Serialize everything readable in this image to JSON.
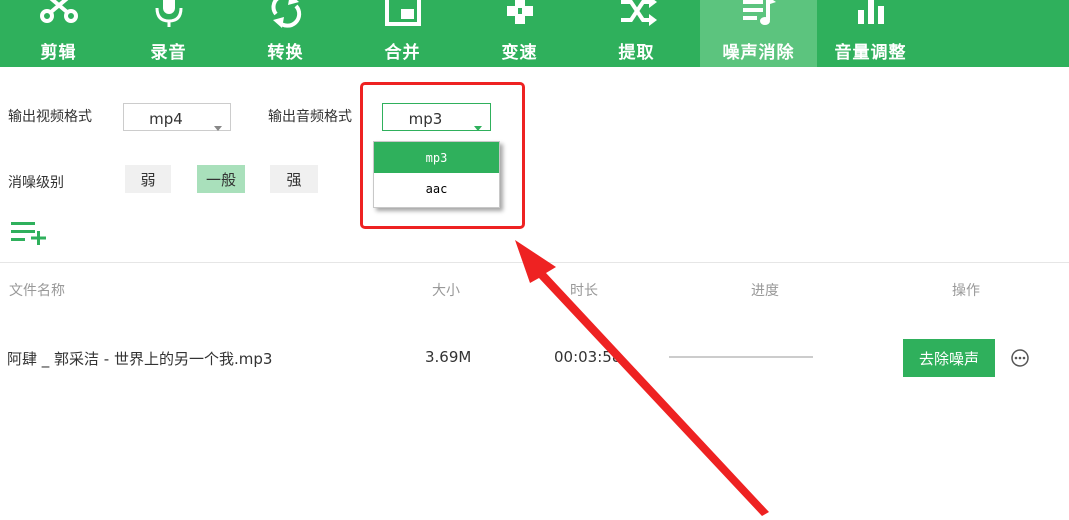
{
  "toolbar": {
    "tools": [
      {
        "label": "剪辑",
        "icon": "scissors-icon"
      },
      {
        "label": "录音",
        "icon": "microphone-icon"
      },
      {
        "label": "转换",
        "icon": "convert-cycle-icon"
      },
      {
        "label": "合并",
        "icon": "merge-window-icon"
      },
      {
        "label": "变速",
        "icon": "speed-gamepad-icon"
      },
      {
        "label": "提取",
        "icon": "shuffle-extract-icon"
      },
      {
        "label": "噪声消除",
        "icon": "noise-remove-music-icon"
      },
      {
        "label": "音量调整",
        "icon": "volume-bars-icon"
      }
    ],
    "active_index": 6
  },
  "settings": {
    "video_format_label": "输出视频格式",
    "video_format_value": "mp4",
    "audio_format_label": "输出音频格式",
    "audio_format_value": "mp3",
    "audio_format_options": [
      "mp3",
      "aac"
    ],
    "noise_level_label": "消噪级别",
    "noise_levels": [
      "弱",
      "一般",
      "强"
    ],
    "selected_noise_level": "一般"
  },
  "add_file_icon": "add-list-icon",
  "table": {
    "headers": {
      "name": "文件名称",
      "size": "大小",
      "duration": "时长",
      "progress": "进度",
      "action": "操作"
    },
    "rows": [
      {
        "name": "阿肆 _ 郭采洁 - 世界上的另一个我.mp3",
        "size": "3.69M",
        "duration": "00:03:58",
        "action_label": "去除噪声"
      }
    ]
  },
  "colors": {
    "brand_green": "#2fb05c",
    "active_tab": "#5cc47e",
    "selected_level": "#a9e0bb",
    "annotation_red": "#ee2222"
  }
}
